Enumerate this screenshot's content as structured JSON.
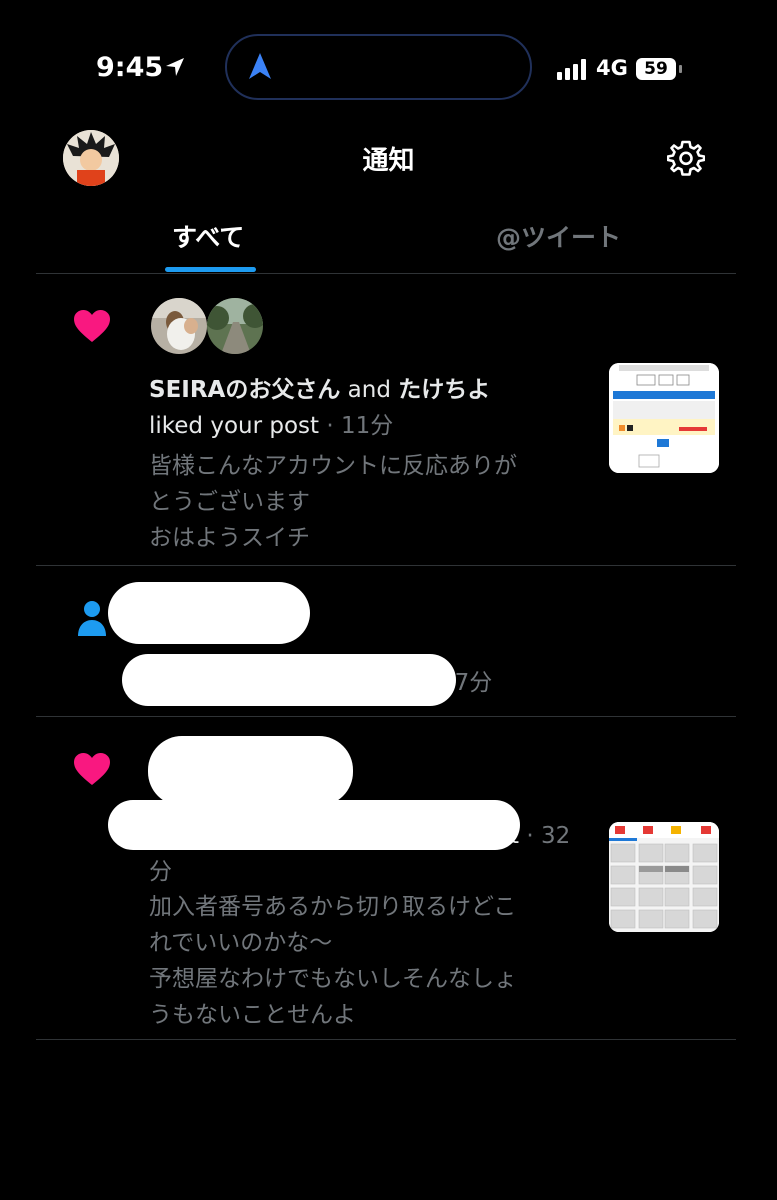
{
  "status_bar": {
    "time": "9:45",
    "network": "4G",
    "battery": "59"
  },
  "header": {
    "title": "通知"
  },
  "tabs": [
    {
      "label": "すべて",
      "active": true
    },
    {
      "label": "@ツイート",
      "active": false
    }
  ],
  "notifications": [
    {
      "type": "like",
      "icon": "heart-icon",
      "names": {
        "first": "SEIRAのお父さん",
        "connector": " and ",
        "second": "たけちよ"
      },
      "action": "liked your post",
      "time": " · 11分",
      "post_lines": [
        "皆様こんなアカウントに反応ありが",
        "とうございます",
        "おはようスイチ"
      ]
    },
    {
      "type": "follow",
      "icon": "person-icon",
      "time": "27分"
    },
    {
      "type": "like",
      "icon": "heart-icon",
      "action_partial": "st",
      "time_line1": " · 32",
      "time_line2": "分",
      "post_lines": [
        "加入者番号あるから切り取るけどこ",
        "れでいいのかな〜",
        "予想屋なわけでもないしそんなしょ",
        "うもないことせんよ"
      ]
    }
  ],
  "colors": {
    "background": "#000000",
    "accent": "#1d9bf0",
    "like": "#f91880",
    "muted": "#71767b"
  }
}
